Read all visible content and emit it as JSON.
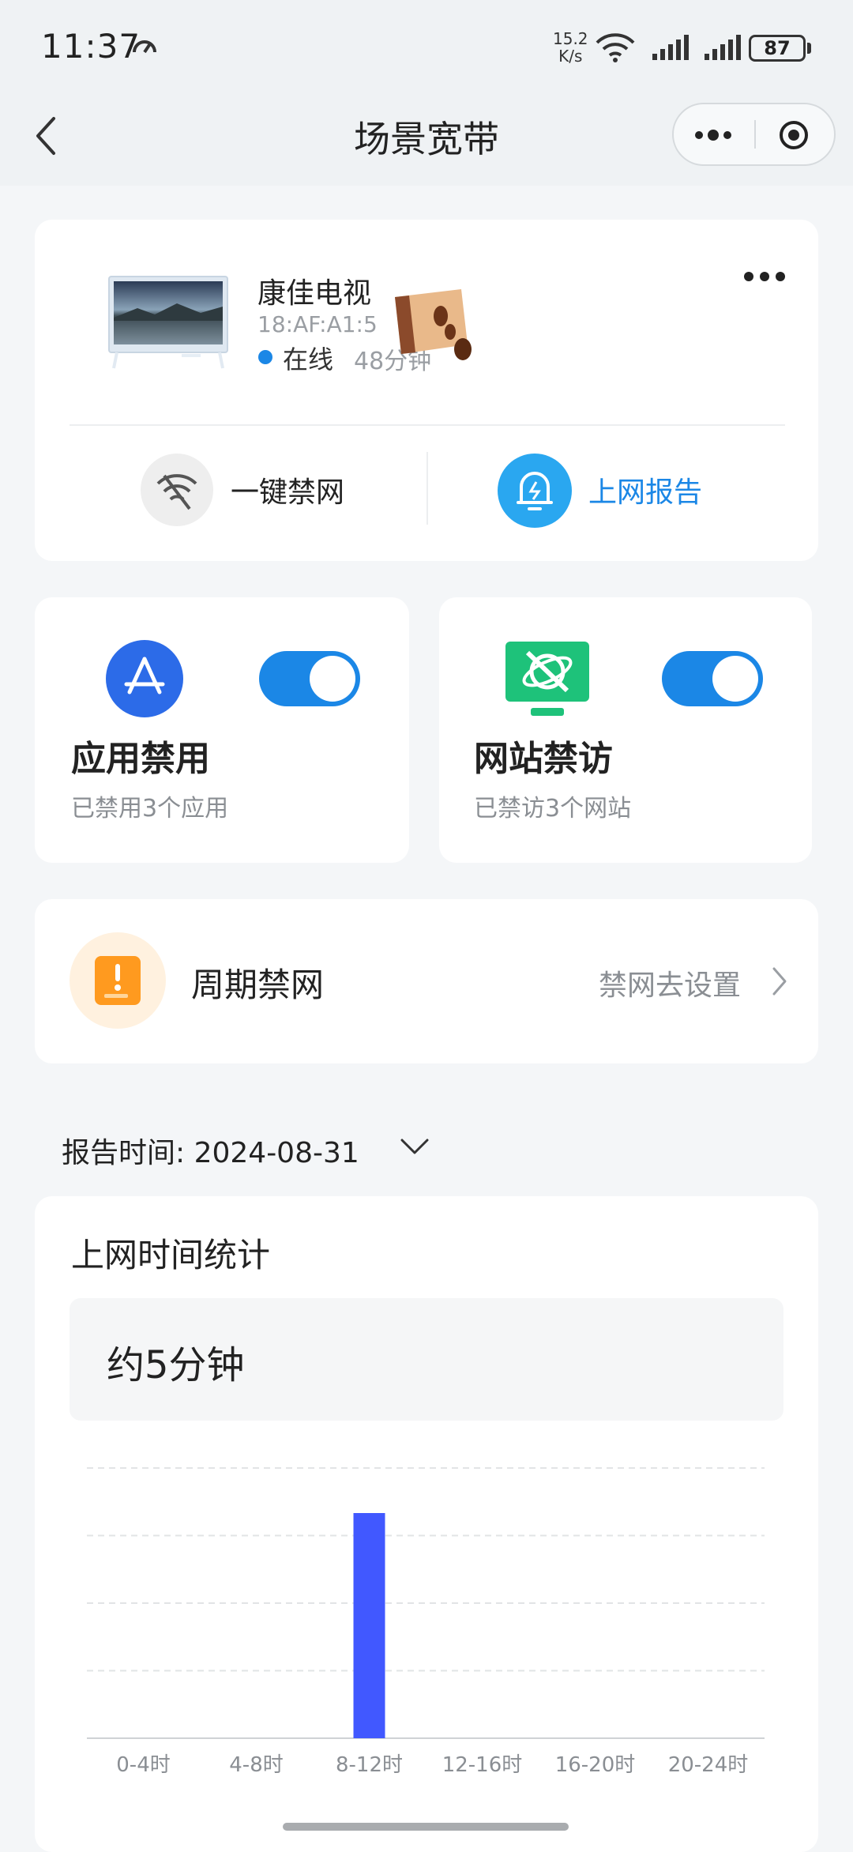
{
  "status_bar": {
    "time": "11:37",
    "speed_value": "15.2",
    "speed_unit": "K/s",
    "battery": "87"
  },
  "header": {
    "title": "场景宽带"
  },
  "device": {
    "name": "康佳电视",
    "mac": "18:AF:A1:5",
    "status": "在线",
    "duration": "48分钟"
  },
  "actions": {
    "block_label": "一键禁网",
    "report_label": "上网报告"
  },
  "features": [
    {
      "title": "应用禁用",
      "subtitle": "已禁用3个应用",
      "enabled": true
    },
    {
      "title": "网站禁访",
      "subtitle": "已禁访3个网站",
      "enabled": true
    }
  ],
  "periodic": {
    "title": "周期禁网",
    "link": "禁网去设置"
  },
  "report": {
    "label": "报告时间: 2024-08-31"
  },
  "stats": {
    "title": "上网时间统计",
    "total": "约5分钟"
  },
  "colors": {
    "accent": "#1b87e6",
    "bar": "#4158ff",
    "feature_green": "#1ec27a",
    "periodic_orange": "#ff9a1f"
  },
  "chart_data": {
    "type": "bar",
    "categories": [
      "0-4时",
      "4-8时",
      "8-12时",
      "12-16时",
      "16-20时",
      "20-24时"
    ],
    "values": [
      0,
      0,
      5,
      0,
      0,
      0
    ],
    "ylim": [
      0,
      6
    ],
    "grid": true
  }
}
